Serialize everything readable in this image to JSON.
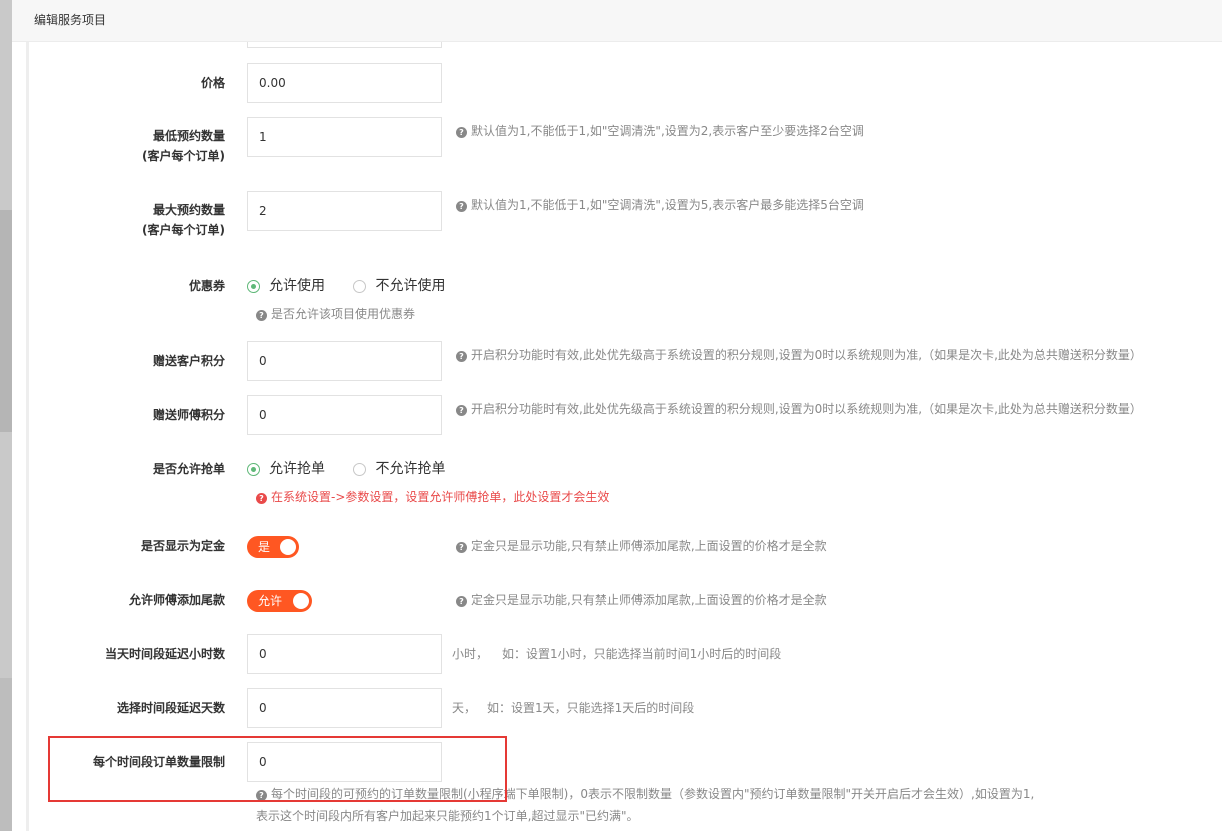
{
  "dialog": {
    "title": "编辑服务项目"
  },
  "fields": {
    "price": {
      "label": "价格",
      "value": "0.00"
    },
    "min_qty": {
      "label_line1": "最低预约数量",
      "label_line2": "(客户每个订单)",
      "value": "1",
      "help": "默认值为1,不能低于1,如\"空调清洗\",设置为2,表示客户至少要选择2台空调"
    },
    "max_qty": {
      "label_line1": "最大预约数量",
      "label_line2": "(客户每个订单)",
      "value": "2",
      "help": "默认值为1,不能低于1,如\"空调清洗\",设置为5,表示客户最多能选择5台空调"
    },
    "coupon": {
      "label": "优惠券",
      "options": [
        "允许使用",
        "不允许使用"
      ],
      "selected": "允许使用",
      "help": "是否允许该项目使用优惠券"
    },
    "customer_points": {
      "label": "赠送客户积分",
      "value": "0",
      "help": "开启积分功能时有效,此处优先级高于系统设置的积分规则,设置为0时以系统规则为准,（如果是次卡,此处为总共赠送积分数量）"
    },
    "master_points": {
      "label": "赠送师傅积分",
      "value": "0",
      "help": "开启积分功能时有效,此处优先级高于系统设置的积分规则,设置为0时以系统规则为准,（如果是次卡,此处为总共赠送积分数量）"
    },
    "grab_order": {
      "label": "是否允许抢单",
      "options": [
        "允许抢单",
        "不允许抢单"
      ],
      "selected": "允许抢单",
      "help": "在系统设置->参数设置，设置允许师傅抢单，此处设置才会生效"
    },
    "deposit": {
      "label": "是否显示为定金",
      "switch_text": "是",
      "on": true,
      "help": "定金只是显示功能,只有禁止师傅添加尾款,上面设置的价格才是全款"
    },
    "tail_payment": {
      "label": "允许师傅添加尾款",
      "switch_text": "允许",
      "on": true,
      "help": "定金只是显示功能,只有禁止师傅添加尾款,上面设置的价格才是全款"
    },
    "delay_hours": {
      "label": "当天时间段延迟小时数",
      "value": "0",
      "unit": "小时，",
      "help": "如：设置1小时，只能选择当前时间1小时后的时间段"
    },
    "delay_days": {
      "label": "选择时间段延迟天数",
      "value": "0",
      "unit": "天，",
      "help": "如：设置1天，只能选择1天后的时间段"
    },
    "slot_limit": {
      "label": "每个时间段订单数量限制",
      "value": "0",
      "help_line1": "每个时间段的可预约的订单数量限制(小程序端下单限制)，0表示不限制数量（参数设置内\"预约订单数量限制\"开关开启后才会生效）,如设置为1,",
      "help_line2": "表示这个时间段内所有客户加起来只能预约1个订单,超过显示\"已约满\"。"
    }
  },
  "colors": {
    "accent": "#ff5722",
    "radio_on": "#5fb878",
    "warning": "#e94a4a",
    "highlight": "#e53935"
  }
}
